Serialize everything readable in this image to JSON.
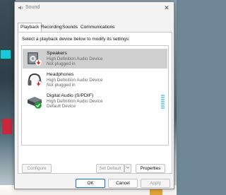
{
  "window": {
    "title": "Sound",
    "close_glyph": "✕",
    "icon": "speaker-icon"
  },
  "tabs": [
    {
      "label": "Playback",
      "active": true
    },
    {
      "label": "Recording",
      "active": false
    },
    {
      "label": "Sounds",
      "active": false
    },
    {
      "label": "Communications",
      "active": false
    }
  ],
  "instruction": "Select a playback device below to modify its settings:",
  "devices": [
    {
      "name": "Speakers",
      "description": "High Definition Audio Device",
      "status": "Not plugged in",
      "icon": "speaker-icon",
      "status_icon": "red-down-arrow-icon",
      "selected": true
    },
    {
      "name": "Headphones",
      "description": "High Definition Audio Device",
      "status": "Not plugged in",
      "icon": "headphones-icon",
      "status_icon": "red-down-arrow-icon",
      "selected": false
    },
    {
      "name": "Digital Audio (S/PDIF)",
      "description": "High Definition Audio Device",
      "status": "Default Device",
      "icon": "digital-audio-icon",
      "status_icon": "green-check-icon",
      "selected": false
    }
  ],
  "buttons": {
    "configure": "Configure",
    "set_default": "Set Default",
    "properties": "Properties",
    "ok": "OK",
    "cancel": "Cancel",
    "apply": "Apply"
  },
  "colors": {
    "accent": "#1a6fd0",
    "selection": "#cfcfcf",
    "level_meter": "#7fd3e8"
  }
}
